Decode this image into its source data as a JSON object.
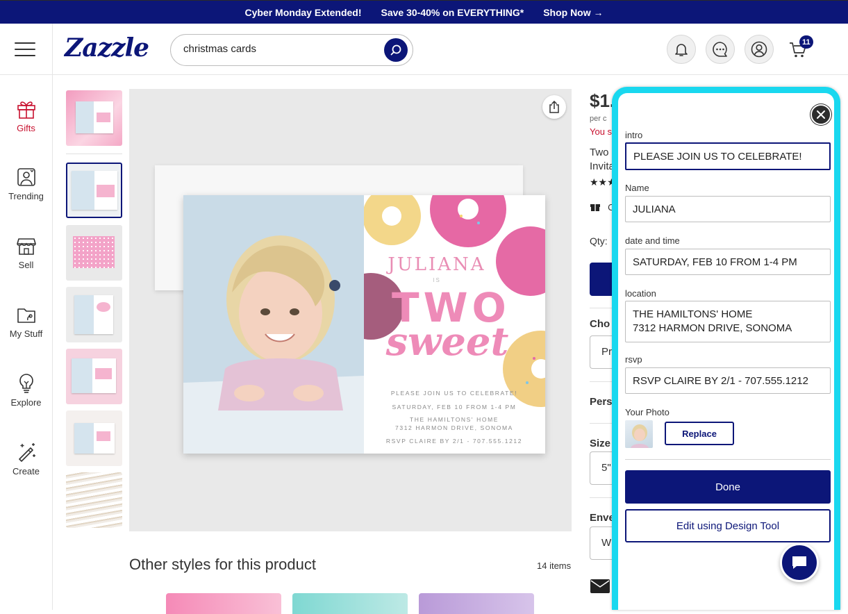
{
  "promo": {
    "item1": "Cyber Monday Extended!",
    "item2": "Save 30-40% on EVERYTHING*",
    "item3": "Shop Now →"
  },
  "header": {
    "logo": "Zazzle",
    "search_value": "christmas cards",
    "cart_count": "11"
  },
  "rail": {
    "gifts": "Gifts",
    "trending": "Trending",
    "sell": "Sell",
    "my_stuff": "My Stuff",
    "explore": "Explore",
    "create": "Create"
  },
  "card": {
    "name": "JULIANA",
    "is": "IS",
    "two": "TWO",
    "sweet": "sweet",
    "intro": "PLEASE JOIN US TO CELEBRATE!",
    "datetime": "SATURDAY, FEB 10 FROM 1-4 PM",
    "location_line1": "THE HAMILTONS' HOME",
    "location_line2": "7312 HARMON DRIVE, SONOMA",
    "rsvp": "RSVP CLAIRE BY 2/1 - 707.555.1212"
  },
  "other_styles": {
    "title": "Other styles for this product",
    "count": "14 items"
  },
  "product": {
    "price": "$1.",
    "per": "per c",
    "save": "You s",
    "title_l1": "Two",
    "title_l2": "Invita",
    "gift": "C",
    "qty": "Qty:",
    "choose": "Cho",
    "choose_val": "Pr",
    "personalize": "Pers",
    "size": "Size",
    "size_val": "5\"",
    "envelope": "Enve",
    "env_val": "W"
  },
  "editor": {
    "intro_label": "intro",
    "intro_value": "PLEASE JOIN US TO CELEBRATE!",
    "name_label": "Name",
    "name_value": "JULIANA",
    "datetime_label": "date and time",
    "datetime_value": "SATURDAY, FEB 10 FROM 1-4 PM",
    "location_label": "location",
    "location_value": "THE HAMILTONS' HOME\n7312 HARMON DRIVE, SONOMA",
    "rsvp_label": "rsvp",
    "rsvp_value": "RSVP CLAIRE BY 2/1 - 707.555.1212",
    "photo_label": "Your Photo",
    "replace": "Replace",
    "done": "Done",
    "design_tool": "Edit using Design Tool"
  },
  "colors": {
    "brand_navy": "#0c1678",
    "panel_border": "#19d8ef",
    "gifts_red": "#c8102e",
    "donut_pink": "#ee8bb8"
  },
  "icons": [
    "hamburger-icon",
    "search-icon",
    "bell-icon",
    "chat-bubble-icon",
    "account-icon",
    "cart-icon",
    "gift-icon",
    "trending-icon",
    "store-icon",
    "folder-icon",
    "lightbulb-icon",
    "magic-wand-icon",
    "share-icon",
    "close-icon",
    "mail-icon"
  ]
}
